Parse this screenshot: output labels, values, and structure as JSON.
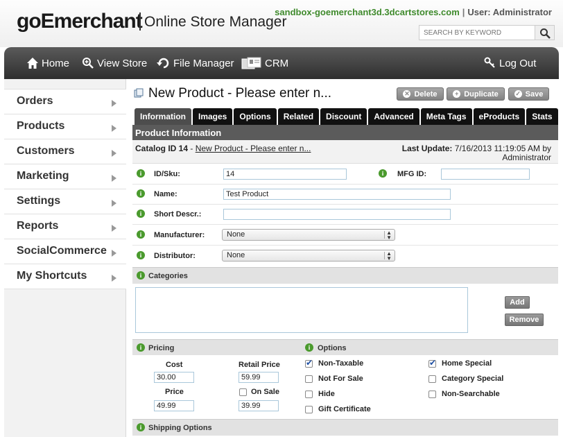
{
  "header": {
    "logo": "goEmerchant",
    "subtitle": "Online Store Manager",
    "store_host": "sandbox-goemerchant3d.3dcartstores.com",
    "separator": "|",
    "user": "User: Administrator",
    "search_placeholder": "SEARCH BY KEYWORD"
  },
  "nav": {
    "home": "Home",
    "view_store": "View Store",
    "file_manager": "File Manager",
    "crm": "CRM",
    "logout": "Log Out"
  },
  "sidebar": {
    "items": [
      {
        "label": "Orders"
      },
      {
        "label": "Products"
      },
      {
        "label": "Customers"
      },
      {
        "label": "Marketing"
      },
      {
        "label": "Settings"
      },
      {
        "label": "Reports"
      },
      {
        "label": "SocialCommerce"
      },
      {
        "label": "My Shortcuts"
      }
    ]
  },
  "main": {
    "title": "New Product - Please enter n...",
    "buttons": {
      "delete": "Delete",
      "duplicate": "Duplicate",
      "save": "Save"
    },
    "tabs": [
      "Information",
      "Images",
      "Options",
      "Related",
      "Discount",
      "Advanced",
      "Meta Tags",
      "eProducts",
      "Stats"
    ],
    "section_title": "Product Information",
    "catalog": {
      "id_label": "Catalog ID 14",
      "dash": " - ",
      "name_link": "New Product - Please enter n...",
      "last_update_label": "Last Update:",
      "last_update_value": "7/16/2013 11:19:05 AM by",
      "last_update_by": "Administrator"
    },
    "fields": {
      "sku_label": "ID/Sku:",
      "sku_value": "14",
      "mfg_label": "MFG ID:",
      "mfg_value": "",
      "name_label": "Name:",
      "name_value": "Test Product",
      "short_label": "Short Descr.:",
      "short_value": "",
      "manufacturer_label": "Manufacturer:",
      "manufacturer_value": "None",
      "distributor_label": "Distributor:",
      "distributor_value": "None"
    },
    "categories": {
      "label": "Categories",
      "add": "Add",
      "remove": "Remove"
    },
    "pricing": {
      "label": "Pricing",
      "cost_label": "Cost",
      "cost_value": "30.00",
      "retail_label": "Retail Price",
      "retail_value": "59.99",
      "price_label": "Price",
      "price_value": "49.99",
      "onsale_label": "On Sale",
      "onsale_value": "39.99",
      "onsale_checked": false
    },
    "options": {
      "label": "Options",
      "items": [
        {
          "label": "Non-Taxable",
          "checked": true
        },
        {
          "label": "Not For Sale",
          "checked": false
        },
        {
          "label": "Hide",
          "checked": false
        },
        {
          "label": "Gift Certificate",
          "checked": false
        },
        {
          "label": "Home Special",
          "checked": true
        },
        {
          "label": "Category Special",
          "checked": false
        },
        {
          "label": "Non-Searchable",
          "checked": false
        }
      ]
    },
    "shipping": {
      "label": "Shipping Options"
    }
  },
  "colors": {
    "accent_green": "#4a9a2d",
    "host_green": "#3f8a2c",
    "nav_dark": "#2f2f2f",
    "tab_black": "#111111",
    "section_gray": "#5b5b5b",
    "checkbox_blue": "#1e4fa3"
  }
}
